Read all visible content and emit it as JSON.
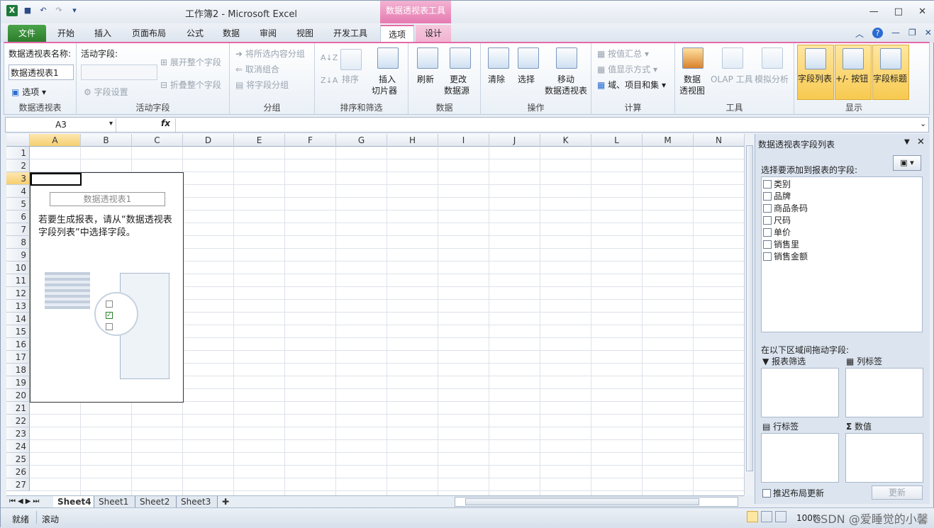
{
  "window": {
    "title": "工作簿2 - Microsoft Excel",
    "context_tab": "数据透视表工具"
  },
  "tabs": [
    "文件",
    "开始",
    "插入",
    "页面布局",
    "公式",
    "数据",
    "审阅",
    "视图",
    "开发工具",
    "选项",
    "设计"
  ],
  "ribbon": {
    "pivot": {
      "name_label": "数据透视表名称:",
      "name_value": "数据透视表1",
      "options": "选项",
      "group": "数据透视表"
    },
    "active_field": {
      "label": "活动字段:",
      "settings": "字段设置",
      "expand": "展开整个字段",
      "collapse": "折叠整个字段",
      "group": "活动字段"
    },
    "grouping": {
      "group_selection": "将所选内容分组",
      "ungroup": "取消组合",
      "group_field": "将字段分组",
      "group": "分组"
    },
    "sort": {
      "sort": "排序",
      "insert_slicer_1": "插入",
      "insert_slicer_2": "切片器",
      "group": "排序和筛选"
    },
    "data": {
      "refresh": "刷新",
      "change_1": "更改",
      "change_2": "数据源",
      "group": "数据"
    },
    "actions": {
      "clear": "清除",
      "select": "选择",
      "move_1": "移动",
      "move_2": "数据透视表",
      "group": "操作"
    },
    "calc": {
      "summarize": "按值汇总",
      "show_as": "值显示方式",
      "fields_items": "域、项目和集",
      "group": "计算"
    },
    "tools": {
      "pivotchart_1": "数据",
      "pivotchart_2": "透视图",
      "olap": "OLAP 工具",
      "whatif": "模拟分析",
      "group": "工具"
    },
    "show": {
      "field_list": "字段列表",
      "buttons": "+/- 按钮",
      "headers": "字段标题",
      "group": "显示"
    }
  },
  "formula_bar": {
    "name_box": "A3",
    "fx": "fx",
    "value": ""
  },
  "grid": {
    "columns": [
      "A",
      "B",
      "C",
      "D",
      "E",
      "F",
      "G",
      "H",
      "I",
      "J",
      "K",
      "L",
      "M",
      "N"
    ],
    "rows": [
      "1",
      "2",
      "3",
      "4",
      "5",
      "6",
      "7",
      "8",
      "9",
      "10",
      "11",
      "12",
      "13",
      "14",
      "15",
      "16",
      "17",
      "18",
      "19",
      "20",
      "21",
      "22",
      "23",
      "24",
      "25",
      "26",
      "27"
    ],
    "selected_col": "A",
    "selected_row": "3"
  },
  "pivot_placeholder": {
    "title": "数据透视表1",
    "hint": "若要生成报表，请从“数据透视表字段列表”中选择字段。"
  },
  "field_list": {
    "title": "数据透视表字段列表",
    "choose_label": "选择要添加到报表的字段:",
    "fields": [
      "类别",
      "品牌",
      "商品条码",
      "尺码",
      "单价",
      "销售里",
      "销售金额"
    ],
    "drag_label": "在以下区域间拖动字段:",
    "areas": {
      "filter": "报表筛选",
      "columns": "列标签",
      "rows": "行标签",
      "values": "数值"
    },
    "defer_label": "推迟布局更新",
    "update_button": "更新"
  },
  "sheets": [
    "Sheet4",
    "Sheet1",
    "Sheet2",
    "Sheet3"
  ],
  "active_sheet": "Sheet4",
  "status": {
    "ready": "就绪",
    "scroll": "滚动",
    "zoom": "100%",
    "watermark": "CSDN @爱睡觉的小馨"
  }
}
